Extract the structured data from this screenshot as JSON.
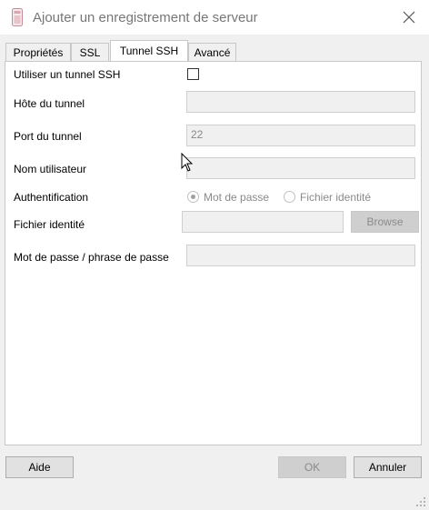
{
  "window": {
    "title": "Ajouter un enregistrement de serveur"
  },
  "tabs": [
    {
      "label": "Propriétés",
      "active": false
    },
    {
      "label": "SSL",
      "active": false
    },
    {
      "label": "Tunnel SSH",
      "active": true
    },
    {
      "label": "Avancé",
      "active": false
    }
  ],
  "form": {
    "use_tunnel_label": "Utiliser un tunnel SSH",
    "use_tunnel_checked": false,
    "host_label": "Hôte du tunnel",
    "host_value": "",
    "port_label": "Port du tunnel",
    "port_value": "22",
    "username_label": "Nom utilisateur",
    "username_value": "",
    "auth_label": "Authentification",
    "auth_options": [
      {
        "label": "Mot de passe",
        "selected": true
      },
      {
        "label": "Fichier identité",
        "selected": false
      }
    ],
    "identity_label": "Fichier identité",
    "identity_value": "",
    "browse_label": "Browse",
    "password_label": "Mot de passe / phrase de passe",
    "password_value": ""
  },
  "footer": {
    "help_label": "Aide",
    "ok_label": "OK",
    "cancel_label": "Annuler"
  },
  "icons": {
    "app": "database-file-icon",
    "close": "close-icon",
    "cursor": "mouse-pointer-icon",
    "grip": "resize-grip-icon"
  }
}
